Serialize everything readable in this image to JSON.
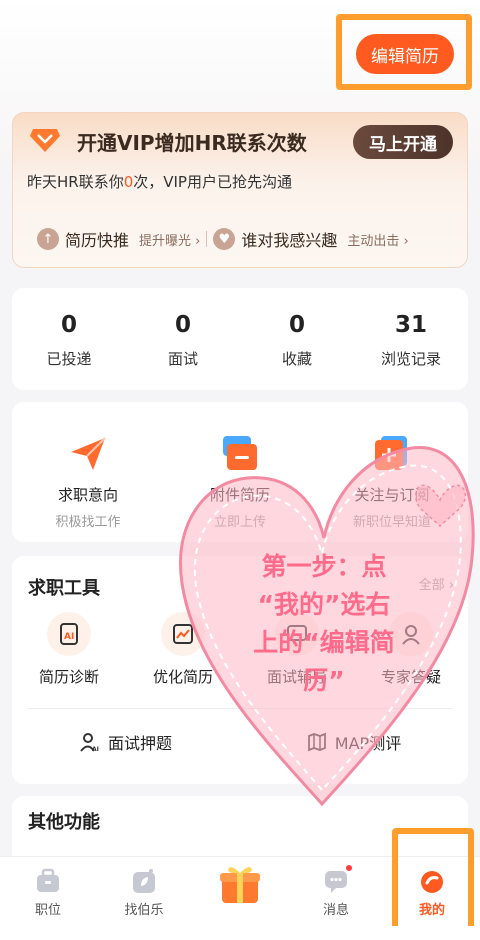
{
  "header": {
    "edit_resume": "编辑简历"
  },
  "vip": {
    "title": "开通VIP增加HR联系次数",
    "button": "马上开通",
    "sub_before": "昨天HR联系你",
    "sub_count": "0",
    "sub_after": "次，VIP用户已抢先沟通",
    "items": [
      {
        "title": "简历快推",
        "sub": "提升曝光 ›"
      },
      {
        "title": "谁对我感兴趣",
        "sub": "主动出击 ›"
      }
    ]
  },
  "stats": [
    {
      "value": "0",
      "label": "已投递"
    },
    {
      "value": "0",
      "label": "面试"
    },
    {
      "value": "0",
      "label": "收藏"
    },
    {
      "value": "31",
      "label": "浏览记录"
    }
  ],
  "features": [
    {
      "title": "求职意向",
      "sub": "积极找工作"
    },
    {
      "title": "附件简历",
      "sub": "立即上传"
    },
    {
      "title": "关注与订阅",
      "sub": "新职位早知道"
    }
  ],
  "tools": {
    "heading": "求职工具",
    "all": "全部 ›",
    "items": [
      {
        "label": "简历诊断"
      },
      {
        "label": "优化简历"
      },
      {
        "label": "面试辅导"
      },
      {
        "label": "专家答疑"
      }
    ],
    "bottom": [
      {
        "label": "面试押题"
      },
      {
        "label": "MAP测评"
      }
    ]
  },
  "other": {
    "heading": "其他功能"
  },
  "nav": [
    {
      "label": "职位"
    },
    {
      "label": "找伯乐"
    },
    {
      "label": ""
    },
    {
      "label": "消息"
    },
    {
      "label": "我的"
    }
  ],
  "overlay": {
    "line1": "第一步：点",
    "line2": "“我的”选右",
    "line3": "上的“编辑简",
    "line4": "历”"
  },
  "colors": {
    "accent": "#ff5a1f",
    "highlight": "#ff9d2e",
    "overlay": "#ff6b8a"
  }
}
